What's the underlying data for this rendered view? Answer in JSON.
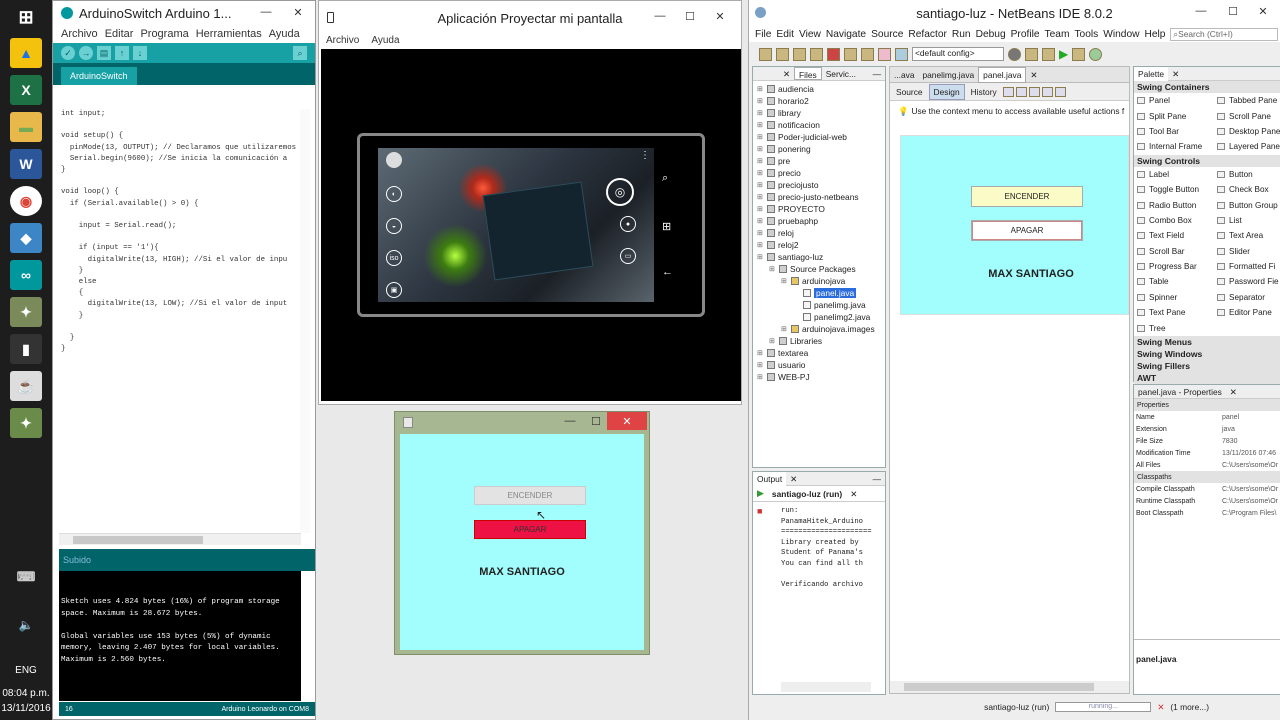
{
  "taskbar": {
    "lang": "ENG",
    "time": "08:04 p.m.",
    "date": "13/11/2016"
  },
  "arduino": {
    "title": "ArduinoSwitch Arduino 1...",
    "menu": [
      "Archivo",
      "Editar",
      "Programa",
      "Herramientas",
      "Ayuda"
    ],
    "tab": "ArduinoSwitch",
    "code_lines": [
      "int input;",
      "",
      "void setup() {",
      "  pinMode(13, OUTPUT); // Declaramos que utilizaremos",
      "  Serial.begin(9600); //Se inicia la comunicación a",
      "}",
      "",
      "void loop() {",
      "  if (Serial.available() > 0) {",
      "",
      "    input = Serial.read();",
      "",
      "    if (input == '1'){",
      "      digitalWrite(13, HIGH); //Si el valor de inpu",
      "    }",
      "    else",
      "    {",
      "      digitalWrite(13, LOW); //Si el valor de input",
      "    }",
      "",
      "  }",
      "}"
    ],
    "console_status": "Subido",
    "console_lines": [
      "Sketch uses 4.824 bytes (16%) of program storage space. Maximum is 28.672 bytes.",
      "",
      "Global variables use 153 bytes (5%) of dynamic memory, leaving 2.407 bytes for local variables. Maximum is 2.560 bytes."
    ],
    "line_no": "16",
    "board": "Arduino Leonardo on COM8"
  },
  "projector": {
    "title": "Aplicación Proyectar mi pantalla",
    "menu": [
      "Archivo",
      "Ayuda"
    ]
  },
  "java_window": {
    "button_on": "ENCENDER",
    "button_off": "APAGAR",
    "label": "MAX SANTIAGO",
    "off_color": "#ee1144",
    "bg": "#a2fdfd"
  },
  "netbeans": {
    "title": "santiago-luz - NetBeans IDE 8.0.2",
    "menu": [
      "File",
      "Edit",
      "View",
      "Navigate",
      "Source",
      "Refactor",
      "Run",
      "Debug",
      "Profile",
      "Team",
      "Tools",
      "Window",
      "Help"
    ],
    "search_placeholder": "Search (Ctrl+I)",
    "config": "<default config>",
    "left_tabs": [
      "Files",
      "Servic..."
    ],
    "tree": [
      {
        "label": "audiencia",
        "level": 0
      },
      {
        "label": "horario2",
        "level": 0
      },
      {
        "label": "library",
        "level": 0
      },
      {
        "label": "notificacion",
        "level": 0
      },
      {
        "label": "Poder-judicial-web",
        "level": 0
      },
      {
        "label": "ponering",
        "level": 0
      },
      {
        "label": "pre",
        "level": 0
      },
      {
        "label": "precio",
        "level": 0
      },
      {
        "label": "preciojusto",
        "level": 0
      },
      {
        "label": "precio-justo-netbeans",
        "level": 0
      },
      {
        "label": "PROYECTO",
        "level": 0
      },
      {
        "label": "pruebaphp",
        "level": 0
      },
      {
        "label": "reloj",
        "level": 0
      },
      {
        "label": "reloj2",
        "level": 0
      },
      {
        "label": "santiago-luz",
        "level": 0
      },
      {
        "label": "Source Packages",
        "level": 1
      },
      {
        "label": "arduinojava",
        "level": 2
      },
      {
        "label": "panel.java",
        "level": 3
      },
      {
        "label": "panelimg.java",
        "level": 3
      },
      {
        "label": "panelimg2.java",
        "level": 3
      },
      {
        "label": "arduinojava.images",
        "level": 2
      },
      {
        "label": "Libraries",
        "level": 1
      },
      {
        "label": "textarea",
        "level": 0
      },
      {
        "label": "usuario",
        "level": 0
      },
      {
        "label": "WEB-PJ",
        "level": 0
      }
    ],
    "editor_tabs": [
      "...ava",
      "panelimg.java",
      "panel.java"
    ],
    "view_tabs": [
      "Source",
      "Design",
      "History"
    ],
    "hint": "Use the context menu to access available useful actions f",
    "design": {
      "button_on": "ENCENDER",
      "button_off": "APAGAR",
      "label": "MAX SANTIAGO"
    },
    "output_tab": "Output",
    "run_tab": "santiago-luz (run)",
    "output_lines": [
      "run:",
      "PanamaHitek_Arduino",
      "=====================",
      "Library created by",
      "Student of Panama's",
      "You can find all th",
      "",
      "Verificando archivo"
    ],
    "palette_tab": "Palette",
    "palette": [
      {
        "head": "Swing Containers",
        "items": [
          "Panel",
          "Tabbed Pane",
          "Split Pane",
          "Scroll Pane",
          "Tool Bar",
          "Desktop Pane",
          "Internal Frame",
          "Layered Pane"
        ]
      },
      {
        "head": "Swing Controls",
        "items": [
          "Label",
          "Button",
          "Toggle Button",
          "Check Box",
          "Radio Button",
          "Button Group",
          "Combo Box",
          "List",
          "Text Field",
          "Text Area",
          "Scroll Bar",
          "Slider",
          "Progress Bar",
          "Formatted Fi",
          "Table",
          "Password Fie",
          "Spinner",
          "Separator",
          "Text Pane",
          "Editor Pane",
          "Tree"
        ]
      },
      {
        "head": "Swing Menus",
        "items": []
      },
      {
        "head": "Swing Windows",
        "items": []
      },
      {
        "head": "Swing Fillers",
        "items": []
      },
      {
        "head": "AWT",
        "items": []
      }
    ],
    "props_tab": "panel.java - Properties",
    "props_head": "Properties",
    "props": [
      {
        "k": "Name",
        "v": "panel"
      },
      {
        "k": "Extension",
        "v": "java"
      },
      {
        "k": "File Size",
        "v": "7830"
      },
      {
        "k": "Modification Time",
        "v": "13/11/2016 07:46"
      },
      {
        "k": "All Files",
        "v": "C:\\Users\\some\\Or"
      }
    ],
    "classpaths_head": "Classpaths",
    "classpaths": [
      {
        "k": "Compile Classpath",
        "v": "C:\\Users\\some\\Or"
      },
      {
        "k": "Runtime Classpath",
        "v": "C:\\Users\\some\\Or"
      },
      {
        "k": "Boot Classpath",
        "v": "C:\\Program Files\\"
      }
    ],
    "selected_file": "panel.java",
    "status_run": "santiago-luz (run)",
    "status_progress": "running...",
    "status_more": "(1 more...)"
  }
}
